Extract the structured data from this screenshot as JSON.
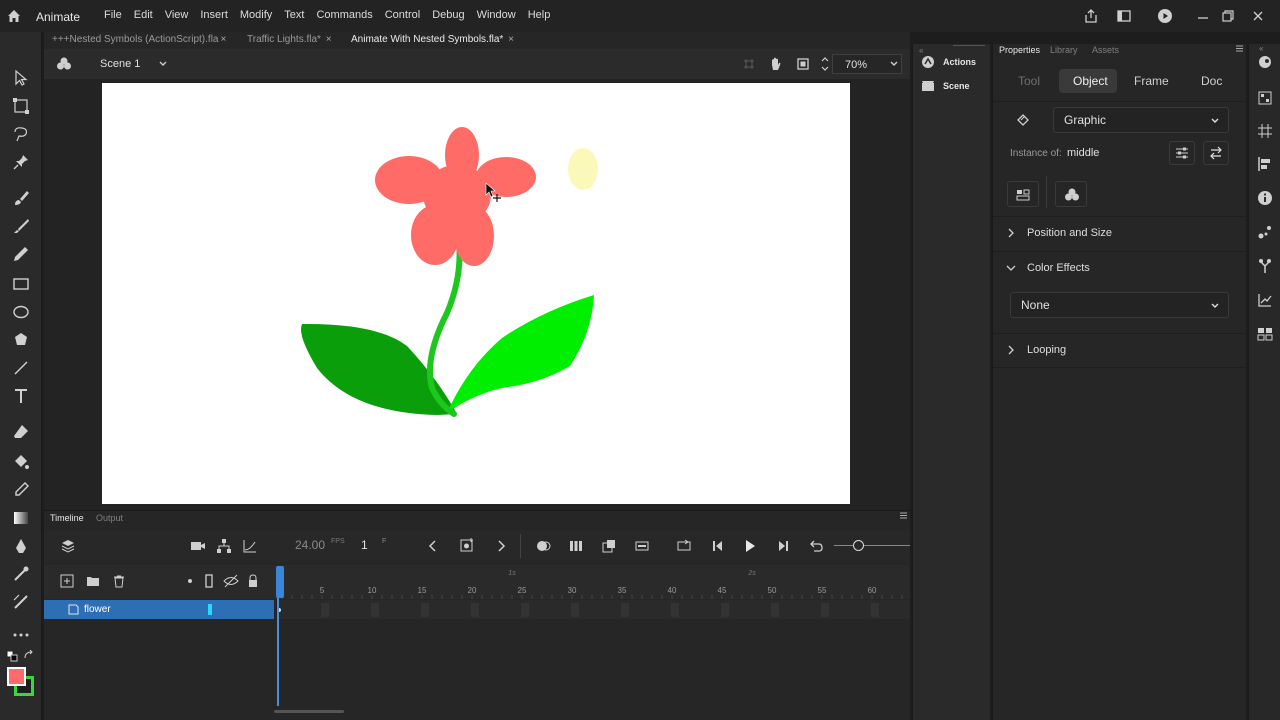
{
  "app": {
    "name": "Animate"
  },
  "menu": [
    "File",
    "Edit",
    "View",
    "Insert",
    "Modify",
    "Text",
    "Commands",
    "Control",
    "Debug",
    "Window",
    "Help"
  ],
  "doc_tabs": [
    {
      "label": "Nested Symbols (ActionScript).fla",
      "close": "×"
    },
    {
      "label": "Traffic Lights.fla*",
      "close": "×"
    },
    {
      "label": "Animate With Nested Symbols.fla*",
      "close": "×"
    }
  ],
  "doc_tabs_prefix": "+++",
  "scene": {
    "name": "Scene 1",
    "zoom": "70%"
  },
  "timeline": {
    "tabs": {
      "timeline": "Timeline",
      "output": "Output"
    },
    "fps": "24.00",
    "fps_unit": "FPS",
    "frame": "1",
    "frame_unit": "F",
    "ruler": [
      "5",
      "10",
      "15",
      "20",
      "25",
      "30",
      "35",
      "40",
      "45",
      "50",
      "55",
      "60"
    ],
    "seconds": [
      "1s",
      "2s"
    ],
    "layer": {
      "name": "flower"
    }
  },
  "side_panel": {
    "actions": "Actions",
    "scene": "Scene"
  },
  "properties": {
    "tabs": {
      "properties": "Properties",
      "library": "Library",
      "assets": "Assets"
    },
    "subtabs": {
      "tool": "Tool",
      "object": "Object",
      "frame": "Frame",
      "doc": "Doc"
    },
    "symbol_type": "Graphic",
    "instance_label": "Instance of:",
    "instance_value": "middle",
    "sections": {
      "position_size": "Position and Size",
      "color_effects": "Color Effects",
      "color_effect_value": "None",
      "looping": "Looping"
    }
  },
  "colors": {
    "stroke": "#ffffff",
    "fill": "#ff6b6b",
    "accent": "#2d6fb5"
  }
}
